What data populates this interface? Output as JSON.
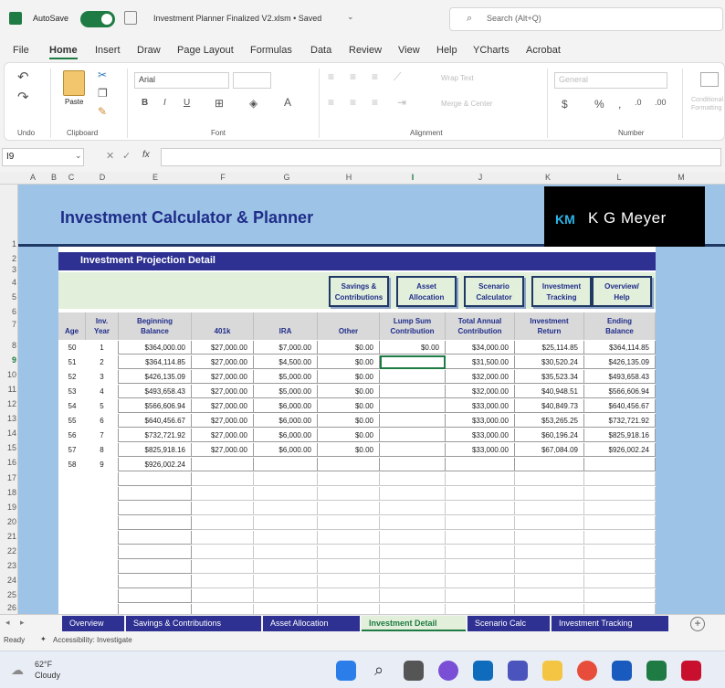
{
  "window": {
    "autosave_label": "AutoSave",
    "file_title": "Investment Planner Finalized V2.xlsm • Saved",
    "search_placeholder": "Search (Alt+Q)"
  },
  "menu": [
    "File",
    "Home",
    "Insert",
    "Draw",
    "Page Layout",
    "Formulas",
    "Data",
    "Review",
    "View",
    "Help",
    "YCharts",
    "Acrobat"
  ],
  "ribbon": {
    "groups": [
      "Undo",
      "Clipboard",
      "Font",
      "Alignment",
      "Number"
    ],
    "paste_label": "Paste",
    "font_name": "Arial",
    "number_format": "General",
    "wrap_text": "Wrap Text",
    "merge_center": "Merge & Center",
    "conditional_formatting": "Conditional Formatting",
    "bold": "B",
    "italic": "I",
    "underline": "U"
  },
  "formula_bar": {
    "name_box": "I9",
    "fx": "fx"
  },
  "columns": [
    "A",
    "B",
    "C",
    "D",
    "E",
    "F",
    "G",
    "H",
    "I",
    "J",
    "K",
    "L",
    "M"
  ],
  "rows": [
    "1",
    "2",
    "3",
    "4",
    "5",
    "6",
    "7",
    "8",
    "9",
    "10",
    "11",
    "12",
    "13",
    "14",
    "15",
    "16",
    "17",
    "18",
    "19",
    "20",
    "21",
    "22",
    "23",
    "24",
    "25",
    "26"
  ],
  "banner": {
    "title": "Investment Calculator & Planner",
    "logo": "K G Meyer",
    "logo_mark": "KM"
  },
  "section_title": "Investment Projection Detail",
  "nav_buttons": [
    {
      "line1": "Savings &",
      "line2": "Contributions"
    },
    {
      "line1": "Asset",
      "line2": "Allocation"
    },
    {
      "line1": "Scenario",
      "line2": "Calculator"
    },
    {
      "line1": "Investment",
      "line2": "Tracking"
    },
    {
      "line1": "Overview/",
      "line2": "Help"
    }
  ],
  "table": {
    "headers": [
      {
        "line1": "",
        "line2": "Age"
      },
      {
        "line1": "Inv.",
        "line2": "Year"
      },
      {
        "line1": "Beginning",
        "line2": "Balance"
      },
      {
        "line1": "",
        "line2": "401k"
      },
      {
        "line1": "",
        "line2": "IRA"
      },
      {
        "line1": "",
        "line2": "Other"
      },
      {
        "line1": "Lump Sum",
        "line2": "Contribution"
      },
      {
        "line1": "Total Annual",
        "line2": "Contribution"
      },
      {
        "line1": "Investment",
        "line2": "Return"
      },
      {
        "line1": "Ending",
        "line2": "Balance"
      }
    ],
    "rows": [
      [
        "50",
        "1",
        "$364,000.00",
        "$27,000.00",
        "$7,000.00",
        "$0.00",
        "$0.00",
        "$34,000.00",
        "$25,114.85",
        "$364,114.85"
      ],
      [
        "51",
        "2",
        "$364,114.85",
        "$27,000.00",
        "$4,500.00",
        "$0.00",
        "",
        "$31,500.00",
        "$30,520.24",
        "$426,135.09"
      ],
      [
        "52",
        "3",
        "$426,135.09",
        "$27,000.00",
        "$5,000.00",
        "$0.00",
        "",
        "$32,000.00",
        "$35,523.34",
        "$493,658.43"
      ],
      [
        "53",
        "4",
        "$493,658.43",
        "$27,000.00",
        "$5,000.00",
        "$0.00",
        "",
        "$32,000.00",
        "$40,948.51",
        "$566,606.94"
      ],
      [
        "54",
        "5",
        "$566,606.94",
        "$27,000.00",
        "$6,000.00",
        "$0.00",
        "",
        "$33,000.00",
        "$40,849.73",
        "$640,456.67"
      ],
      [
        "55",
        "6",
        "$640,456.67",
        "$27,000.00",
        "$6,000.00",
        "$0.00",
        "",
        "$33,000.00",
        "$53,265.25",
        "$732,721.92"
      ],
      [
        "56",
        "7",
        "$732,721.92",
        "$27,000.00",
        "$6,000.00",
        "$0.00",
        "",
        "$33,000.00",
        "$60,196.24",
        "$825,918.16"
      ],
      [
        "57",
        "8",
        "$825,918.16",
        "$27,000.00",
        "$6,000.00",
        "$0.00",
        "",
        "$33,000.00",
        "$67,084.09",
        "$926,002.24"
      ],
      [
        "58",
        "9",
        "$926,002.24",
        "",
        "",
        "",
        "",
        "",
        "",
        ""
      ]
    ]
  },
  "sheet_tabs": [
    "Overview",
    "Savings & Contributions",
    "Asset Allocation",
    "Investment Detail",
    "Scenario Calc",
    "Investment Tracking"
  ],
  "status": {
    "ready": "Ready",
    "accessibility": "Accessibility: Investigate"
  },
  "weather": {
    "temp": "62°F",
    "condition": "Cloudy"
  }
}
